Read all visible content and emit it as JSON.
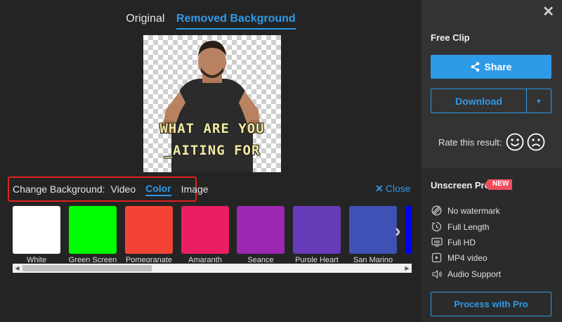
{
  "tabs": [
    {
      "label": "Original",
      "active": false
    },
    {
      "label": "Removed Background",
      "active": true
    }
  ],
  "preview": {
    "caption_line1": "WHAT ARE YOU",
    "caption_line2": "_AITING FOR"
  },
  "background_bar": {
    "label": "Change Background:",
    "options": [
      {
        "label": "Video",
        "active": false
      },
      {
        "label": "Color",
        "active": true
      },
      {
        "label": "Image",
        "active": false
      }
    ],
    "close_label": "Close"
  },
  "swatches": [
    {
      "name": "White",
      "color": "#ffffff"
    },
    {
      "name": "Green Screen",
      "color": "#00ff00"
    },
    {
      "name": "Pomegranate",
      "color": "#f44336"
    },
    {
      "name": "Amaranth",
      "color": "#e91e63"
    },
    {
      "name": "Seance",
      "color": "#9c27b0"
    },
    {
      "name": "Purple Heart",
      "color": "#673ab7"
    },
    {
      "name": "San Marino",
      "color": "#3f51b5"
    },
    {
      "name": "B",
      "color": "#0000ff"
    }
  ],
  "sidebar": {
    "free_clip_label": "Free Clip",
    "share_label": "Share",
    "download_label": "Download",
    "rate_label": "Rate this result:",
    "pro_title": "Unscreen Pro",
    "new_badge": "NEW",
    "features": [
      {
        "icon": "no-watermark-icon",
        "label": "No watermark"
      },
      {
        "icon": "full-length-icon",
        "label": "Full Length"
      },
      {
        "icon": "hd-icon",
        "label": "Full HD"
      },
      {
        "icon": "mp4-video-icon",
        "label": "MP4 video"
      },
      {
        "icon": "audio-icon",
        "label": "Audio Support"
      }
    ],
    "pro_button_label": "Process with Pro"
  },
  "colors": {
    "accent": "#2e9ae8",
    "highlight_border": "#e02020",
    "new_badge": "#f04e5e"
  }
}
